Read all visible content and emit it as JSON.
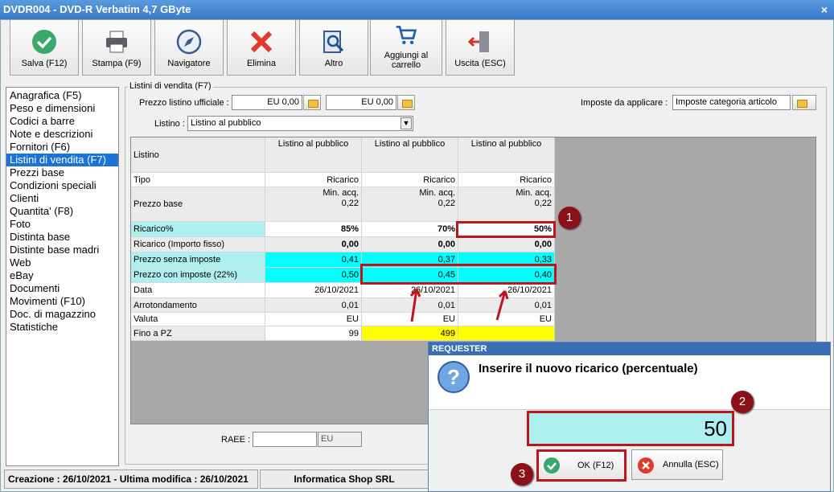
{
  "window": {
    "title": "DVDR004 - DVD-R Verbatim 4,7 GByte",
    "close": "×"
  },
  "toolbar": [
    "Salva (F12)",
    "Stampa (F9)",
    "Navigatore",
    "Elimina",
    "Altro",
    "Aggiungi al carrello",
    "Uscita (ESC)"
  ],
  "sidebar": [
    "Anagrafica (F5)",
    "Peso e dimensioni",
    "Codici a barre",
    "Note e descrizioni",
    "Fornitori (F6)",
    "Listini di vendita (F7)",
    "Prezzi base",
    "Condizioni speciali",
    "Clienti",
    "Quantita' (F8)",
    "Foto",
    "Distinta base",
    "Distinte base madri",
    "Web",
    "eBay",
    "Documenti",
    "Movimenti (F10)",
    "Doc. di magazzino",
    "Statistiche"
  ],
  "sidebar_selected": 5,
  "group_title": "Listini di vendita (F7)",
  "prezzo_label": "Prezzo listino ufficiale :",
  "prezzo1": "EU 0,00",
  "prezzo2": "EU 0,00",
  "imposte_label": "Imposte da applicare :",
  "imposte_value": "Imposte categoria articolo",
  "listino_label": "Listino :",
  "listino_value": "Listino al pubblico",
  "table": {
    "header": [
      "Listino",
      "Listino al pubblico",
      "Listino al pubblico",
      "Listino al pubblico"
    ],
    "rows": [
      [
        "Tipo",
        "Ricarico",
        "Ricarico",
        "Ricarico"
      ],
      [
        "Prezzo base",
        "Min. acq.|0,22",
        "Min. acq.|0,22",
        "Min. acq.|0,22"
      ],
      [
        "Ricarico%",
        "85%",
        "70%",
        "50%"
      ],
      [
        "Ricarico (Importo fisso)",
        "0,00",
        "0,00",
        "0,00"
      ],
      [
        "Prezzo senza imposte",
        "0,41",
        "0,37",
        "0,33"
      ],
      [
        "Prezzo con imposte (22%)",
        "0,50",
        "0,45",
        "0,40"
      ],
      [
        "Data",
        "26/10/2021",
        "26/10/2021",
        "26/10/2021"
      ],
      [
        "Arrotondamento",
        "0,01",
        "0,01",
        "0,01"
      ],
      [
        "Valuta",
        "EU",
        "EU",
        "EU"
      ],
      [
        "Fino a PZ",
        "99",
        "499",
        ""
      ]
    ]
  },
  "raee_label": "RAEE :",
  "raee_unit": "EU",
  "dialog": {
    "title": "REQUESTER",
    "question": "Inserire il nuovo ricarico (percentuale)",
    "value": "50",
    "ok": "OK (F12)",
    "cancel": "Annulla (ESC)"
  },
  "badges": [
    "1",
    "2",
    "3"
  ],
  "status": {
    "dates": "Creazione : 26/10/2021 - Ultima modifica : 26/10/2021",
    "company": "Informatica Shop SRL"
  },
  "colors": {
    "cyan": "#00ffff",
    "lightcyan": "#aef0f0",
    "yellow": "#ffff00",
    "red": "#c0141b"
  }
}
